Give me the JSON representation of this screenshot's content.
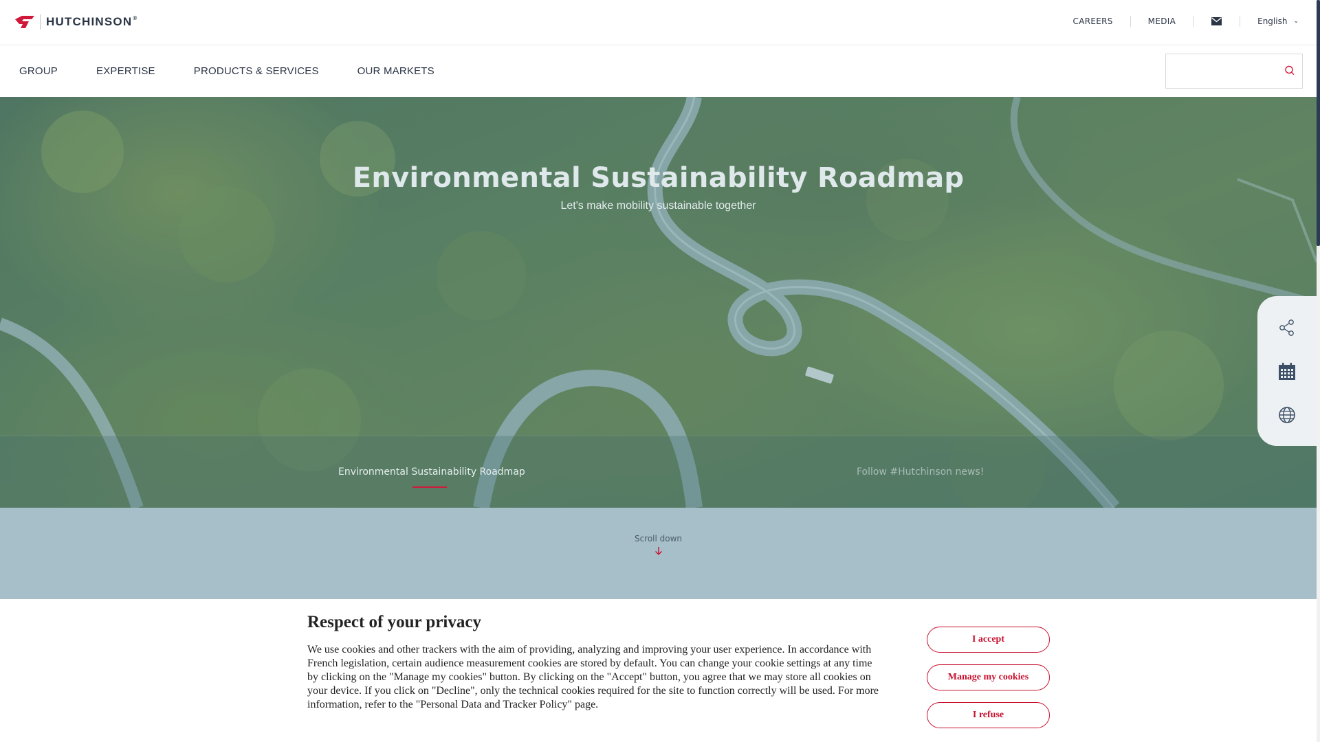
{
  "brand": {
    "name": "HUTCHINSON",
    "registered": "®",
    "accent_color": "#d0183b",
    "text_color": "#2a3444"
  },
  "utility_nav": {
    "careers": "CAREERS",
    "media": "MEDIA",
    "mail_icon": "envelope-icon",
    "language": "English"
  },
  "main_nav": {
    "items": [
      "GROUP",
      "EXPERTISE",
      "PRODUCTS & SERVICES",
      "OUR MARKETS"
    ],
    "search_placeholder": "",
    "search_icon": "search-icon"
  },
  "hero": {
    "title": "Environmental Sustainability Roadmap",
    "subtitle": "Let's make mobility sustainable together",
    "tabs": [
      "Environmental Sustainability Roadmap",
      "Follow #Hutchinson news!"
    ],
    "active_tab": 0
  },
  "side_panel": {
    "icons": [
      "share-icon",
      "calendar-icon",
      "globe-icon"
    ]
  },
  "scroll": {
    "label": "Scroll down",
    "icon": "arrow-down-icon"
  },
  "cookie_banner": {
    "title": "Respect of your privacy",
    "text": "We use cookies and other trackers with the aim of providing, analyzing and improving your user experience. In accordance with French legislation, certain audience measurement cookies are stored by default. You can change your cookie settings at any time by clicking on the \"Manage my cookies\" button. By clicking on the \"Accept\" button, you agree that we may store all cookies on your device. If you click on \"Decline\", only the technical cookies required for the site to function correctly will be used. For more information, refer to the \"Personal Data and Tracker Policy\" page.",
    "accept": "I accept",
    "manage": "Manage my cookies",
    "refuse": "I refuse",
    "button_color": "#c8102e"
  }
}
